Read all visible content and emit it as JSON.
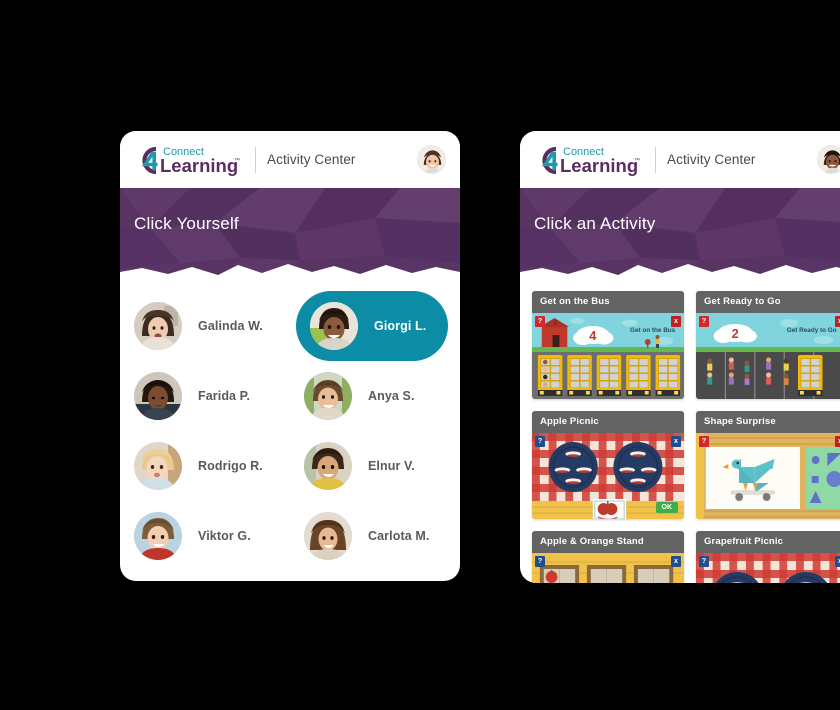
{
  "background_color": "#000000",
  "theme": {
    "purple": "#583462",
    "teal_selected": "#0d8ca5",
    "card_header_gray": "#636363",
    "logo_teal": "#1c9aa8",
    "logo_purple": "#5b2d63"
  },
  "panels": {
    "students": {
      "header": {
        "logo_icon": "connect4learning-logo",
        "logo_word_top": "Connect",
        "logo_word_main": "Learning",
        "logo_numeral": "4",
        "logo_trademark": "™",
        "title": "Activity Center",
        "avatar_icon": "teacher-avatar"
      },
      "banner_title": "Click Yourself",
      "students": [
        {
          "name": "Galinda W.",
          "avatar_icon": "student-avatar-galinda",
          "selected": false
        },
        {
          "name": "Giorgi L.",
          "avatar_icon": "student-avatar-giorgi",
          "selected": true
        },
        {
          "name": "Farida P.",
          "avatar_icon": "student-avatar-farida",
          "selected": false
        },
        {
          "name": "Anya S.",
          "avatar_icon": "student-avatar-anya",
          "selected": false
        },
        {
          "name": "Rodrigo R.",
          "avatar_icon": "student-avatar-rodrigo",
          "selected": false
        },
        {
          "name": "Elnur V.",
          "avatar_icon": "student-avatar-elnur",
          "selected": false
        },
        {
          "name": "Viktor G.",
          "avatar_icon": "student-avatar-viktor",
          "selected": false
        },
        {
          "name": "Carlota M.",
          "avatar_icon": "student-avatar-carlota",
          "selected": false
        }
      ]
    },
    "activities": {
      "header": {
        "logo_icon": "connect4learning-logo",
        "logo_word_top": "Connect",
        "logo_word_main": "Learning",
        "logo_numeral": "4",
        "logo_trademark": "™",
        "title": "Activity Center",
        "avatar_icon": "teacher-avatar"
      },
      "banner_title": "Click an Activity",
      "cards": [
        {
          "title": "Get on the Bus",
          "thumb_icon": "school-buses-scene",
          "scene_label": "Get on the Bus",
          "cloud_number": "4",
          "help_badge": "?",
          "close_badge": "x",
          "badge_style": "red"
        },
        {
          "title": "Get Ready to Go",
          "thumb_icon": "children-parking-lot-scene",
          "scene_label": "Get Ready to Go",
          "cloud_number": "2",
          "help_badge": "?",
          "close_badge": "x",
          "badge_style": "red"
        },
        {
          "title": "Apple Picnic",
          "thumb_icon": "picnic-plates-scene",
          "ok_label": "OK",
          "help_badge": "?",
          "close_badge": "x",
          "badge_style": "blue"
        },
        {
          "title": "Shape Surprise",
          "thumb_icon": "tangram-bird-scene",
          "help_badge": "?",
          "close_badge": "x",
          "badge_style": "red"
        },
        {
          "title": "Apple & Orange Stand",
          "thumb_icon": "fruit-crates-scene",
          "help_badge": "?",
          "close_badge": "x",
          "badge_style": "blue"
        },
        {
          "title": "Grapefruit Picnic",
          "thumb_icon": "grapefruit-picnic-scene",
          "help_badge": "?",
          "close_badge": "x",
          "badge_style": "blue"
        }
      ]
    }
  }
}
